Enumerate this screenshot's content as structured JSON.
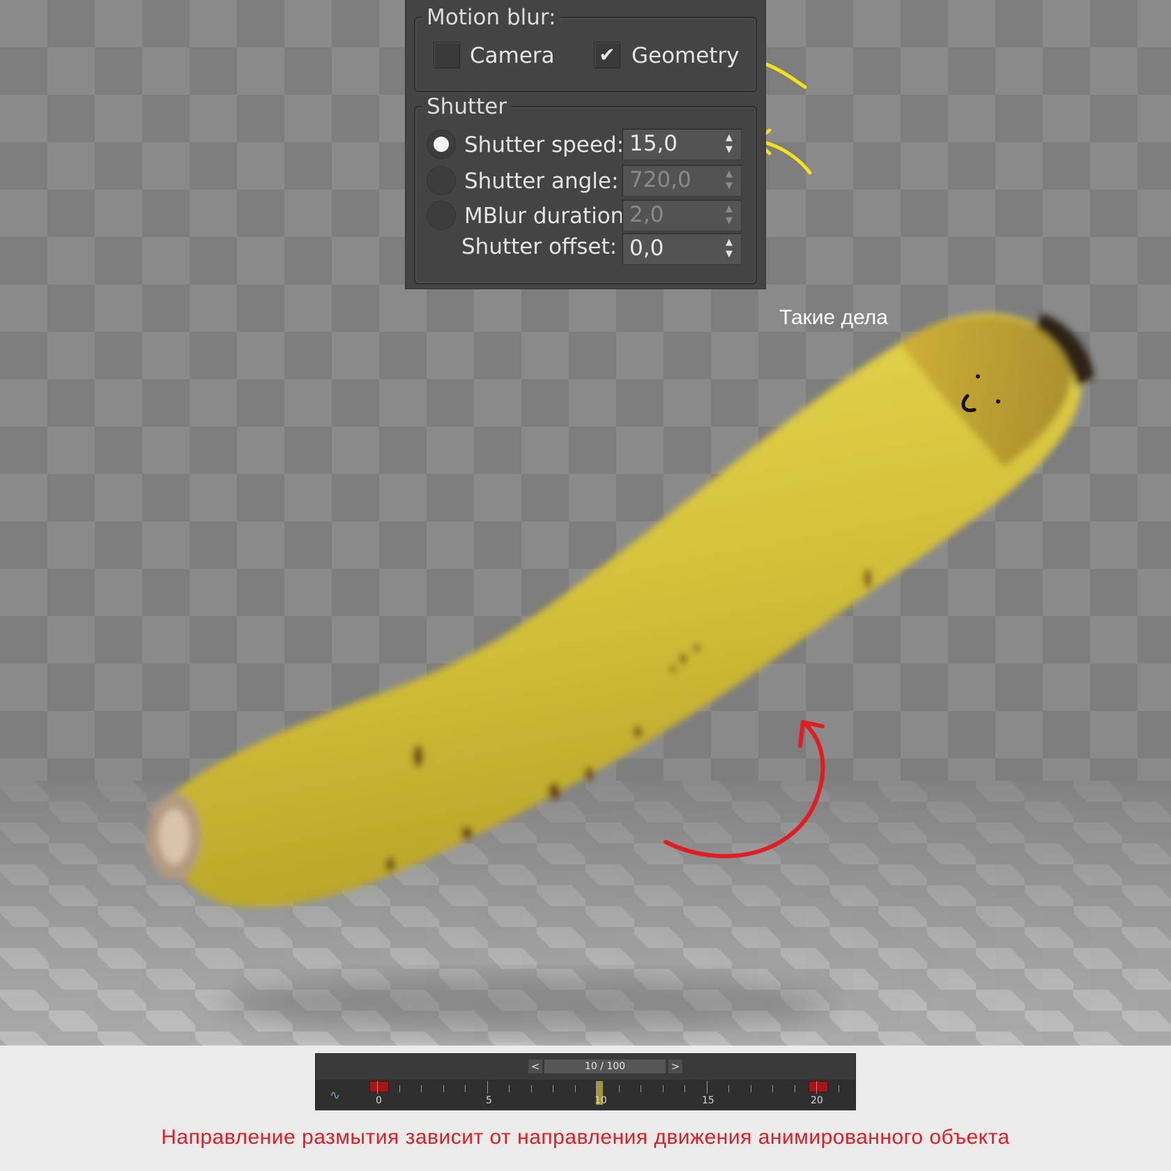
{
  "motion_blur": {
    "title": "Motion blur:",
    "camera": {
      "label": "Camera",
      "checked": false
    },
    "geometry": {
      "label": "Geometry",
      "checked": true,
      "check_glyph": "✔"
    }
  },
  "shutter": {
    "title": "Shutter",
    "rows": [
      {
        "label": "Shutter speed:",
        "value": "15,0",
        "selected": true,
        "enabled": true
      },
      {
        "label": "Shutter angle:",
        "value": "720,0",
        "selected": false,
        "enabled": false
      },
      {
        "label": "MBlur duration:",
        "value": "2,0",
        "selected": false,
        "enabled": false
      },
      {
        "label": "Shutter offset:",
        "value": "0,0",
        "enabled": true
      }
    ],
    "spinner_glyph_up": "▲",
    "spinner_glyph_down": "▼"
  },
  "timeline": {
    "prev": "<",
    "next": ">",
    "frame_display": "10 / 100",
    "ticks": [
      "0",
      "5",
      "10",
      "15",
      "20"
    ],
    "curve_icon": "∿"
  },
  "caption_top": "Такие дела",
  "caption_bottom": "Направление размытия зависит от направления движения анимированного объекта",
  "colors": {
    "accent_yellow": "#f5e21a",
    "accent_red": "#e11d23",
    "banana": "#d7c53a",
    "panel": "#444444"
  }
}
